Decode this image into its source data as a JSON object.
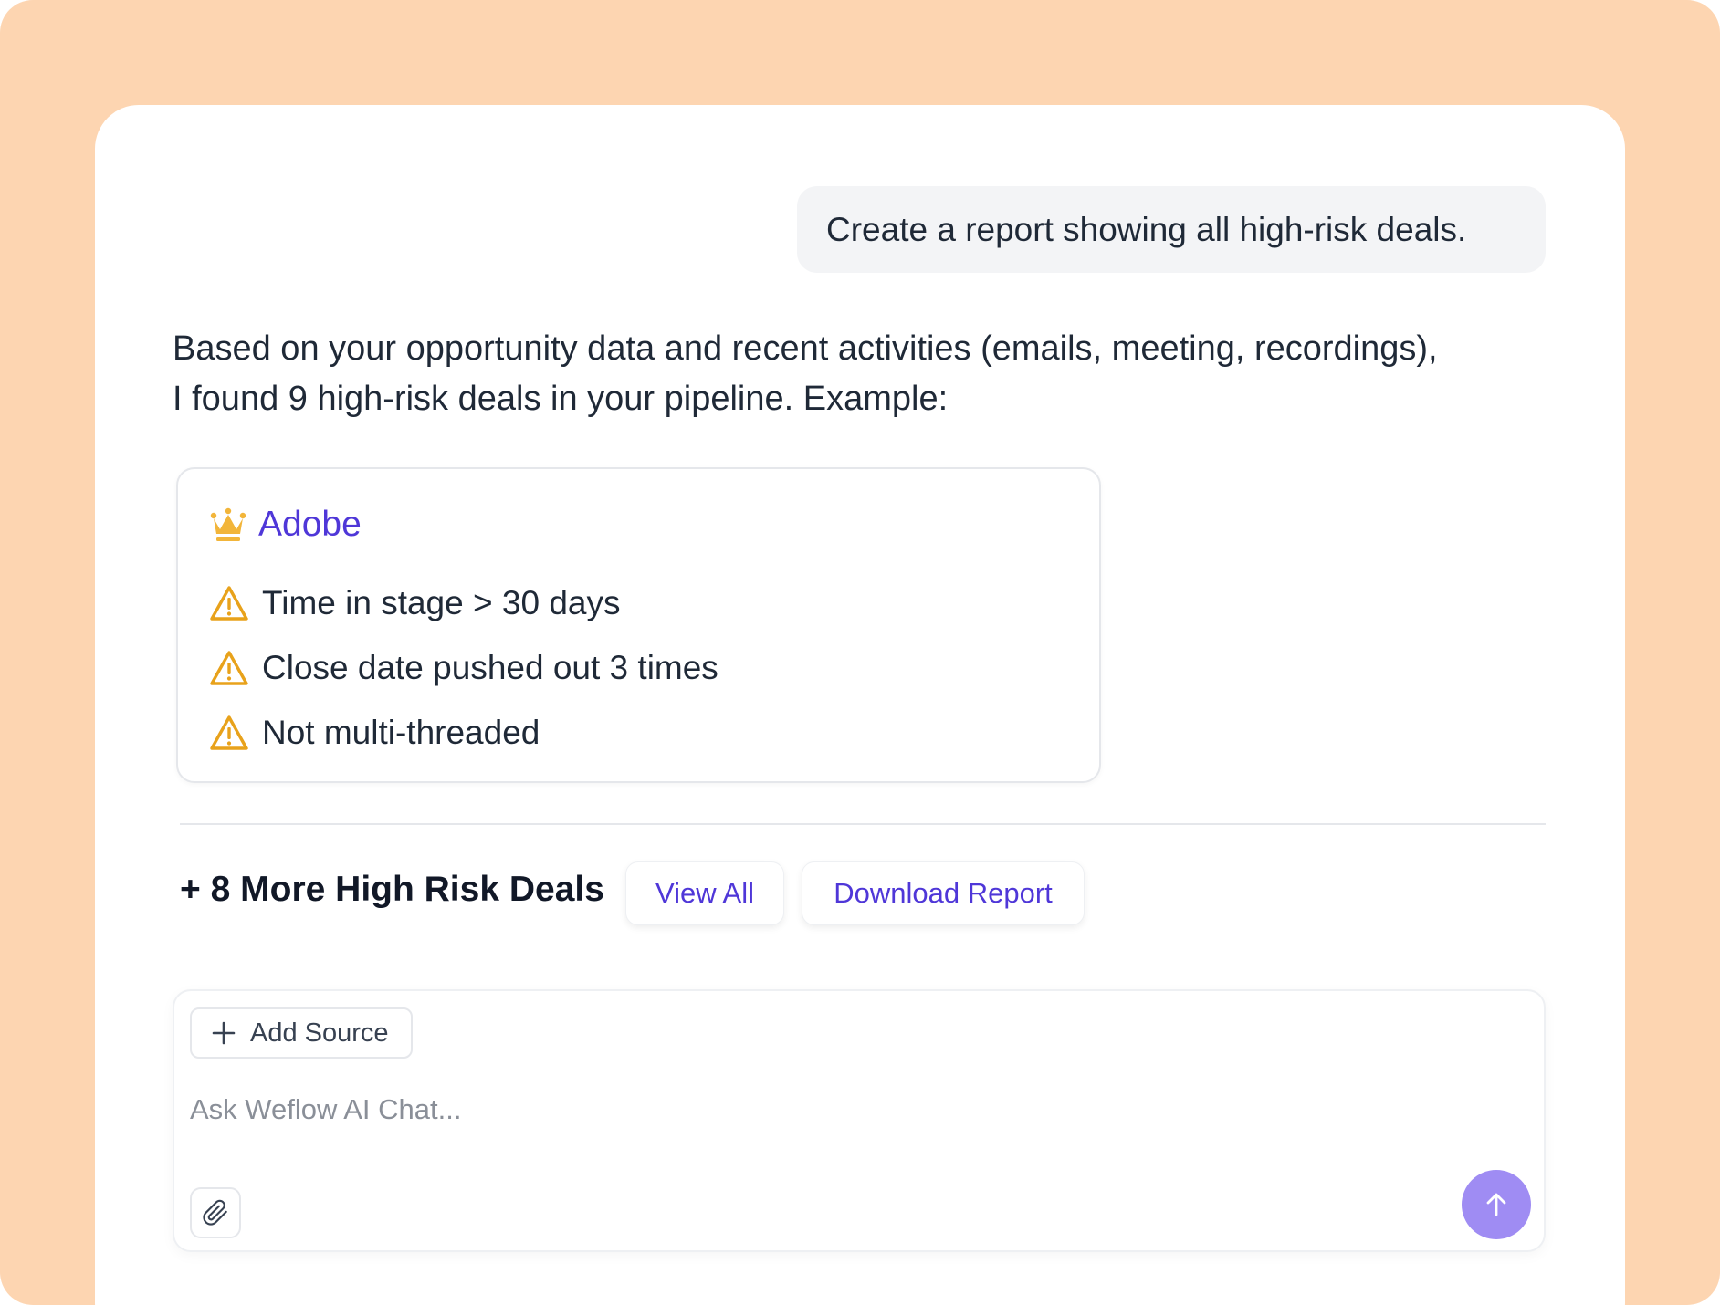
{
  "conversation": {
    "user_message": "Create a report showing all high-risk deals.",
    "assistant_line1": "Based on your opportunity data and recent activities (emails, meeting, recordings),",
    "assistant_line2": "I found 9 high-risk deals in your pipeline. Example:"
  },
  "deal_card": {
    "name": "Adobe",
    "icon": "crown-icon",
    "risks": [
      {
        "label": "Time in stage > 30 days",
        "icon": "warning-icon"
      },
      {
        "label": "Close date pushed out 3 times",
        "icon": "warning-icon"
      },
      {
        "label": "Not multi-threaded",
        "icon": "warning-icon"
      }
    ]
  },
  "summary": {
    "more_deals_label": "+ 8 More High Risk Deals",
    "view_all_label": "View All",
    "download_label": "Download Report"
  },
  "composer": {
    "add_source_label": "Add Source",
    "placeholder": "Ask Weflow AI Chat..."
  },
  "colors": {
    "background": "#FDD5B1",
    "accent": "#4F37D8",
    "warning": "#E8A21B",
    "send_button": "#9F8CF3"
  }
}
